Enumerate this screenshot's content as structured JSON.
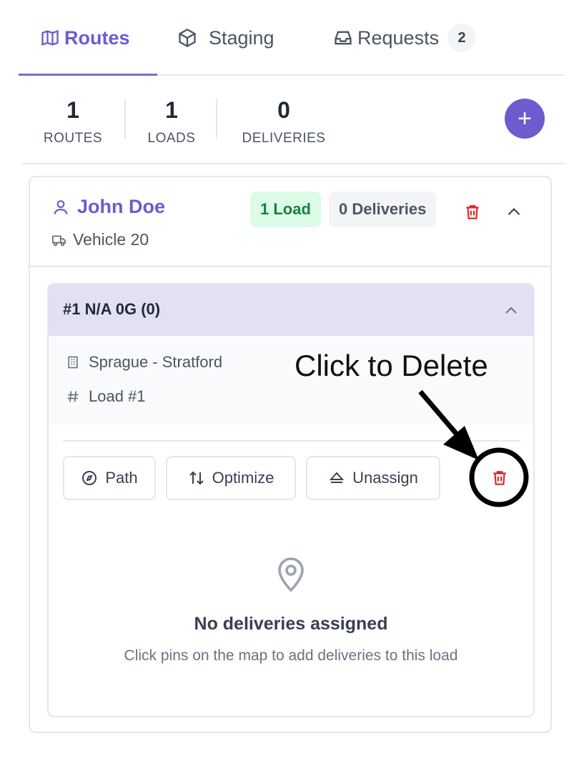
{
  "tabs": [
    {
      "label": "Routes",
      "icon": "map-icon",
      "active": true
    },
    {
      "label": "Staging",
      "icon": "cube-icon"
    },
    {
      "label": "Requests",
      "icon": "inbox-icon",
      "badge": "2"
    }
  ],
  "stats": [
    {
      "value": "1",
      "label": "ROUTES"
    },
    {
      "value": "1",
      "label": "LOADS"
    },
    {
      "value": "0",
      "label": "DELIVERIES"
    }
  ],
  "add_label": "+",
  "route": {
    "driver": "John Doe",
    "vehicle": "Vehicle 20",
    "loads_pill": "1 Load",
    "deliveries_pill": "0 Deliveries"
  },
  "load": {
    "title": "#1 N/A 0G (0)",
    "location": "Sprague - Stratford",
    "load_number": "Load #1",
    "actions": {
      "path": "Path",
      "optimize": "Optimize",
      "unassign": "Unassign"
    },
    "empty_title": "No deliveries assigned",
    "empty_sub": "Click pins on the map to add deliveries to this load"
  },
  "annotation": "Click to Delete",
  "colors": {
    "accent": "#6d5bd0",
    "danger": "#dc2626",
    "success": "#15803d"
  }
}
